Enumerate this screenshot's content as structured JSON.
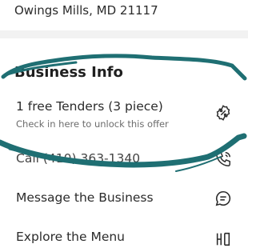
{
  "location": {
    "address": "Owings Mills, MD 21117"
  },
  "business_info": {
    "title": "Business Info"
  },
  "offer": {
    "title": "1 free Tenders (3 piece)",
    "subtitle": "Check in here to unlock this offer",
    "icon": "badge-percent-icon"
  },
  "call": {
    "label": "Call (410) 363-1340",
    "icon": "phone-icon"
  },
  "message": {
    "label": "Message the Business",
    "icon": "chat-bubble-icon"
  },
  "menu": {
    "label": "Explore the Menu",
    "icon": "menu-book-icon"
  },
  "colors": {
    "scribble": "#1f6f73",
    "text": "#2b2b2b",
    "subtext": "#6c6c6c"
  }
}
